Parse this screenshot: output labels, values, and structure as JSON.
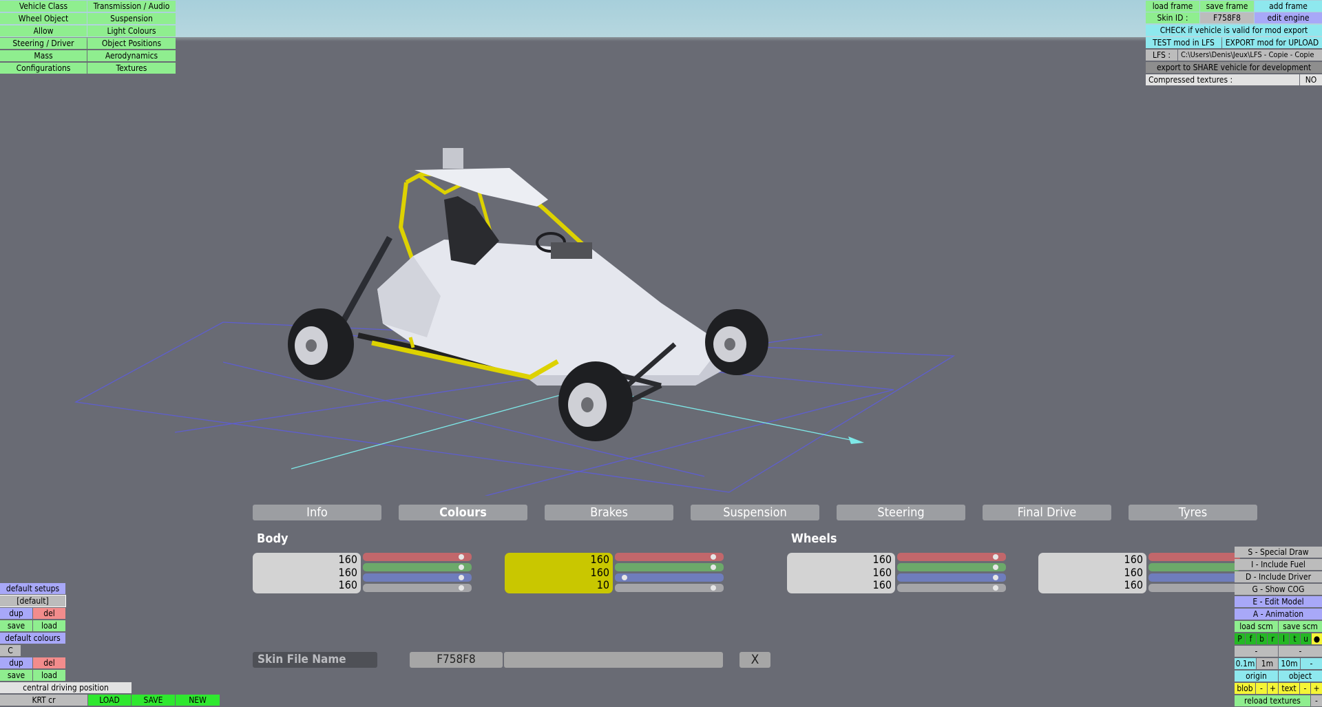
{
  "top_left_menu": [
    "Vehicle Class",
    "Transmission / Audio",
    "Wheel Object",
    "Suspension",
    "Allow",
    "Light Colours",
    "Steering / Driver",
    "Object Positions",
    "Mass",
    "Aerodynamics",
    "Configurations",
    "Textures"
  ],
  "top_right": {
    "load_frame": "load frame",
    "save_frame": "save frame",
    "add_frame": "add frame",
    "skin_id_label": "Skin ID :",
    "skin_id_value": "F758F8",
    "edit_engine": "edit engine",
    "check_valid": "CHECK if vehicle is valid for mod export",
    "test_mod": "TEST mod in LFS",
    "export_mod": "EXPORT mod for UPLOAD",
    "lfs_label": "LFS :",
    "lfs_path": "C:\\Users\\Denis\\Jeux\\LFS - Copie - Copie",
    "export_share": "export to SHARE vehicle for development",
    "compressed_label": "Compressed textures :",
    "compressed_value": "NO"
  },
  "tabs": [
    {
      "label": "Info"
    },
    {
      "label": "Colours"
    },
    {
      "label": "Brakes"
    },
    {
      "label": "Suspension"
    },
    {
      "label": "Steering"
    },
    {
      "label": "Final Drive"
    },
    {
      "label": "Tyres"
    }
  ],
  "sections": {
    "body": "Body",
    "wheels": "Wheels"
  },
  "colour_boxes": [
    {
      "values": [
        "160",
        "160",
        "160"
      ],
      "levels": [
        0.95,
        0.95,
        0.95,
        0.95
      ]
    },
    {
      "values": [
        "160",
        "160",
        "10"
      ],
      "levels": [
        0.95,
        0.95,
        0.04,
        0.95
      ]
    },
    {
      "values": [
        "160",
        "160",
        "160"
      ],
      "levels": [
        0.95,
        0.95,
        0.95,
        0.95
      ]
    },
    {
      "values": [
        "160",
        "160",
        "160"
      ],
      "levels": [
        0.95,
        0.95,
        0.95,
        0.95
      ]
    }
  ],
  "skin": {
    "label": "Skin File Name",
    "value": "F758F8",
    "close": "X"
  },
  "left_panel": {
    "default_setups": "default setups",
    "default_name": "[default]",
    "dup": "dup",
    "del": "del",
    "save": "save",
    "load": "load",
    "default_colours": "default colours",
    "c": "C",
    "dup2": "dup",
    "del2": "del",
    "save2": "save",
    "load2": "load",
    "central": "central driving position",
    "krt": "KRT cr",
    "load_btn": "LOAD",
    "save_btn": "SAVE",
    "new_btn": "NEW"
  },
  "right_panel": {
    "special_draw": "S - Special Draw",
    "include_fuel": "I - Include Fuel",
    "include_driver": "D - Include Driver",
    "show_cog": "G - Show COG",
    "edit_model": "E - Edit Model",
    "animation": "A - Animation",
    "load_scm": "load scm",
    "save_scm": "save scm",
    "letters": [
      "P",
      "f",
      "b",
      "r",
      "l",
      "t",
      "u",
      "●"
    ],
    "minus": "-",
    "minus2": "-",
    "step1": "0.1m",
    "step2": "1m",
    "step3": "10m",
    "step_minus": "-",
    "origin": "origin",
    "object": "object",
    "blob": "blob",
    "bm": "-",
    "bp": "+",
    "text": "text",
    "tm": "-",
    "tp": "+",
    "reload": "reload textures",
    "rm": "-"
  }
}
